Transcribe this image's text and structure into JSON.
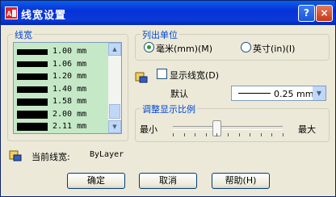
{
  "window": {
    "title": "线宽设置",
    "help_glyph": "?",
    "close_glyph": "×"
  },
  "lineweights": {
    "group_title": "线宽",
    "items": [
      "1.00 mm",
      "1.06 mm",
      "1.20 mm",
      "1.40 mm",
      "1.58 mm",
      "2.00 mm",
      "2.11 mm"
    ],
    "scroll_up": "▲",
    "scroll_down": "▼"
  },
  "units": {
    "group_title": "列出单位",
    "mm_label": "毫米(mm)(M)",
    "inch_label": "英寸(in)(I)",
    "selected": "mm"
  },
  "display": {
    "show_lineweight_label": "显示线宽(D)",
    "show_lineweight_checked": false,
    "default_label": "默认",
    "default_value": "0.25 mm",
    "dropdown_arrow": "▼"
  },
  "scale": {
    "group_title": "调整显示比例",
    "min_label": "最小",
    "max_label": "最大",
    "slider_value": 0.4
  },
  "current": {
    "label": "当前线宽:",
    "value": "ByLayer"
  },
  "buttons": {
    "ok": "确定",
    "cancel": "取消",
    "help": "帮助(H)"
  },
  "colors": {
    "title_bar": "#0831d9",
    "group_title": "#0046d5",
    "list_bg": "#c5e8c7",
    "dialog_bg": "#ece9d8"
  }
}
